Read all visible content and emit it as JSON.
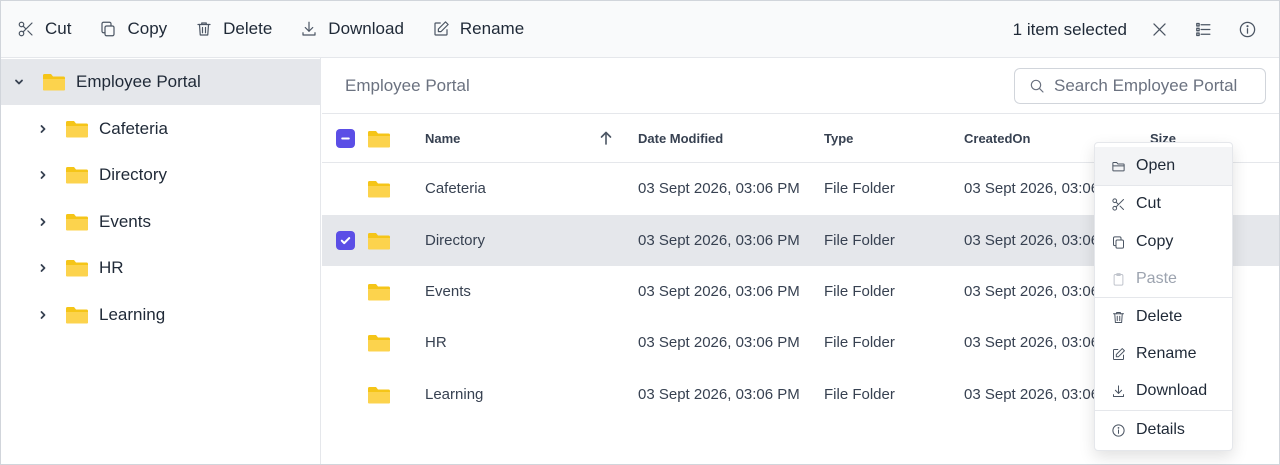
{
  "toolbar": {
    "cut": "Cut",
    "copy": "Copy",
    "delete": "Delete",
    "download": "Download",
    "rename": "Rename",
    "selection": "1 item selected"
  },
  "nav": {
    "root": "Employee Portal",
    "children": [
      "Cafeteria",
      "Directory",
      "Events",
      "HR",
      "Learning"
    ]
  },
  "address": {
    "breadcrumb": "Employee Portal",
    "search_placeholder": "Search Employee Portal"
  },
  "grid": {
    "columns": {
      "name": "Name",
      "modified": "Date Modified",
      "type": "Type",
      "created": "CreatedOn",
      "size": "Size"
    },
    "rows": [
      {
        "name": "Cafeteria",
        "modified": "03 Sept 2026, 03:06 PM",
        "type": "File Folder",
        "created": "03 Sept 2026, 03:06 PM",
        "selected": false
      },
      {
        "name": "Directory",
        "modified": "03 Sept 2026, 03:06 PM",
        "type": "File Folder",
        "created": "03 Sept 2026, 03:06 PM",
        "selected": true
      },
      {
        "name": "Events",
        "modified": "03 Sept 2026, 03:06 PM",
        "type": "File Folder",
        "created": "03 Sept 2026, 03:06 PM",
        "selected": false
      },
      {
        "name": "HR",
        "modified": "03 Sept 2026, 03:06 PM",
        "type": "File Folder",
        "created": "03 Sept 2026, 03:06 PM",
        "selected": false
      },
      {
        "name": "Learning",
        "modified": "03 Sept 2026, 03:06 PM",
        "type": "File Folder",
        "created": "03 Sept 2026, 03:06 PM",
        "selected": false
      }
    ]
  },
  "context_menu": {
    "open": "Open",
    "cut": "Cut",
    "copy": "Copy",
    "paste": "Paste",
    "delete": "Delete",
    "rename": "Rename",
    "download": "Download",
    "details": "Details"
  },
  "colors": {
    "accent": "#5b4ee6",
    "folder": "#fcd34d",
    "selected_row": "#e5e7eb"
  },
  "icons": [
    "scissors-icon",
    "copy-icon",
    "trash-icon",
    "download-icon",
    "edit-icon",
    "close-icon",
    "list-icon",
    "info-icon",
    "search-icon",
    "folder-icon",
    "folder-open-icon",
    "paste-icon",
    "chevron-right-icon",
    "chevron-down-icon",
    "sort-up-icon",
    "check-icon",
    "minus-icon"
  ]
}
